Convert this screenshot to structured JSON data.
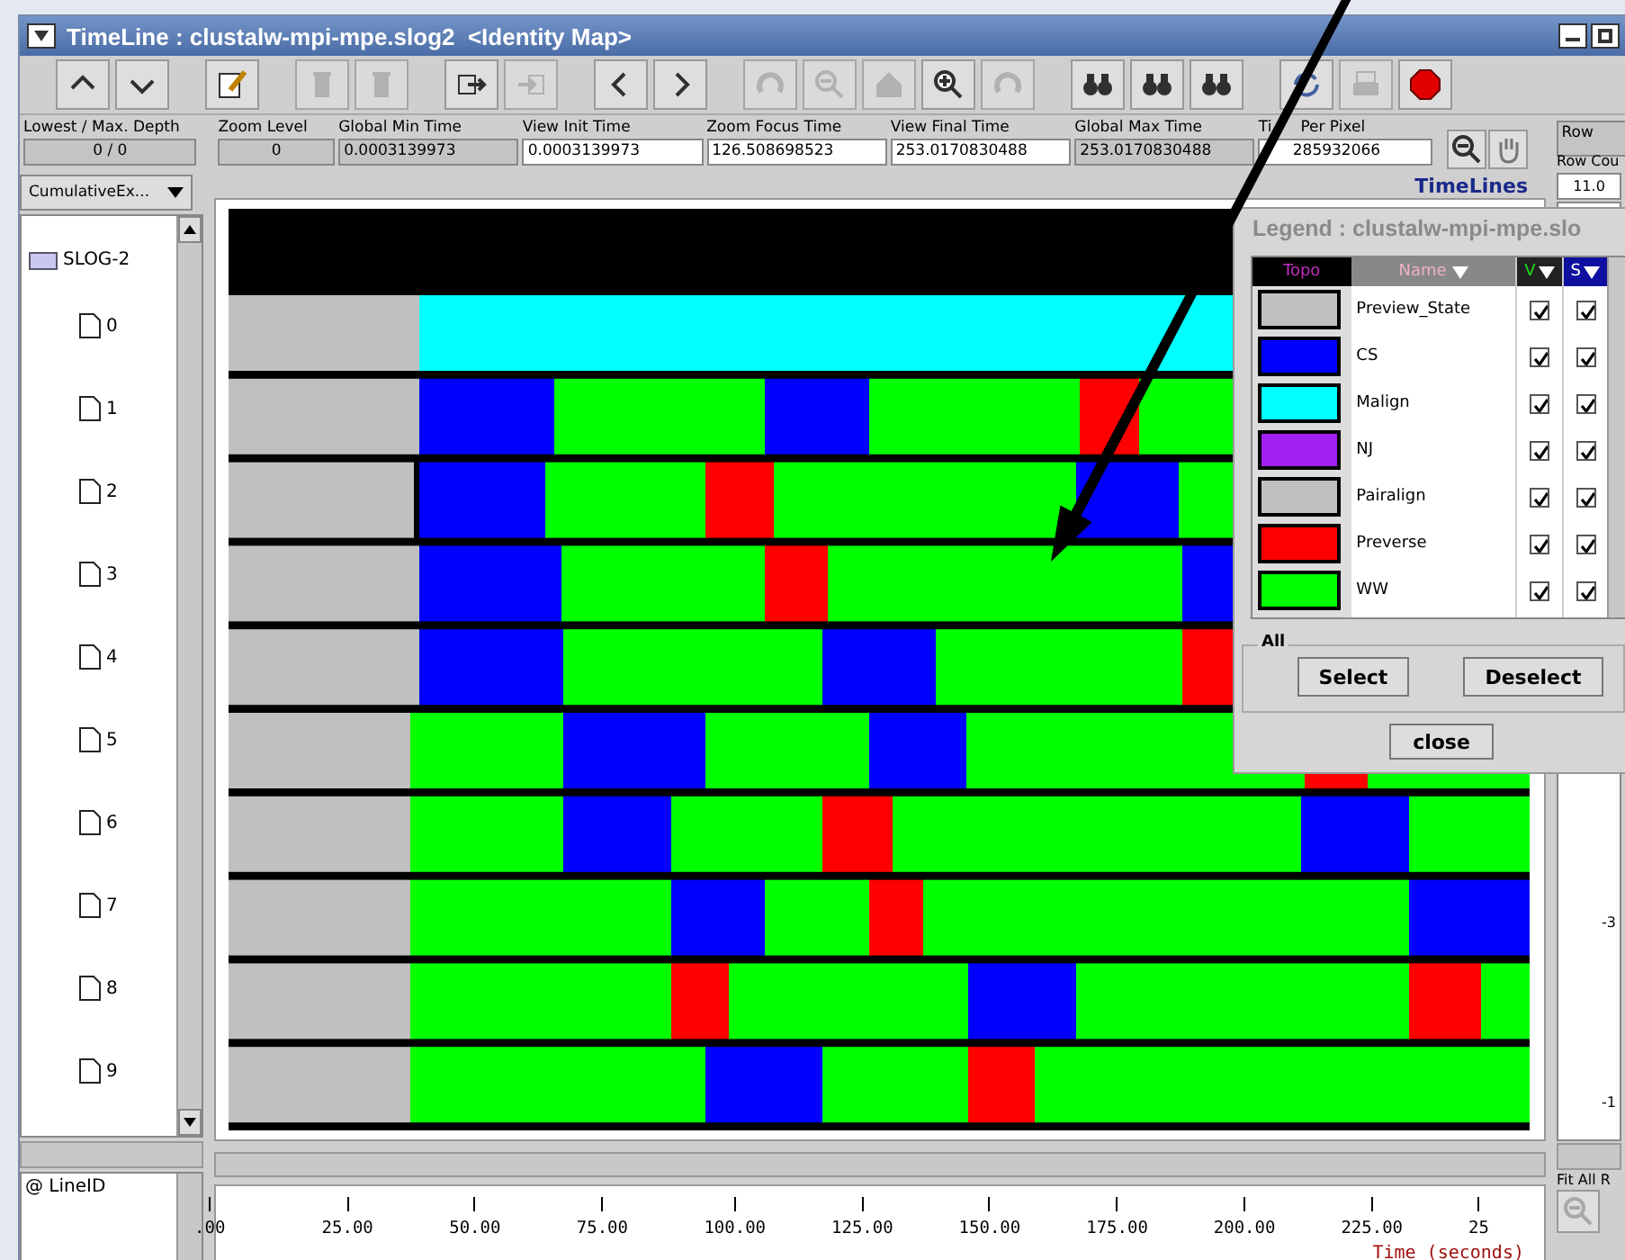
{
  "window": {
    "title": "TimeLine : clustalw-mpi-mpe.slog2  <Identity Map>"
  },
  "toolbar": [
    {
      "kind": "up",
      "disabled": false
    },
    {
      "kind": "down",
      "disabled": false
    },
    {
      "kind": "edit",
      "disabled": false
    },
    {
      "kind": "trash",
      "disabled": true
    },
    {
      "kind": "trash",
      "disabled": true
    },
    {
      "kind": "export",
      "disabled": false
    },
    {
      "kind": "import",
      "disabled": true
    },
    {
      "kind": "left",
      "disabled": false
    },
    {
      "kind": "right",
      "disabled": false
    },
    {
      "kind": "undo",
      "disabled": true
    },
    {
      "kind": "zoomout",
      "disabled": true
    },
    {
      "kind": "home",
      "disabled": true
    },
    {
      "kind": "zoomin",
      "disabled": false
    },
    {
      "kind": "redo",
      "disabled": true
    },
    {
      "kind": "binoculars",
      "disabled": false
    },
    {
      "kind": "binoculars",
      "disabled": false
    },
    {
      "kind": "binoculars",
      "disabled": false
    },
    {
      "kind": "refresh",
      "disabled": false
    },
    {
      "kind": "print",
      "disabled": true
    },
    {
      "kind": "stop",
      "disabled": false
    }
  ],
  "depth": {
    "label": "Lowest / Max. Depth",
    "value": "0 / 0"
  },
  "info_fields": [
    {
      "label": "Zoom Level",
      "value": "0",
      "editable": false
    },
    {
      "label": "Global Min Time",
      "value": "0.0003139973",
      "editable": false
    },
    {
      "label": "View  Init Time",
      "value": "0.0003139973",
      "editable": true
    },
    {
      "label": "Zoom Focus Time",
      "value": "126.508698523",
      "editable": true
    },
    {
      "label": "View Final Time",
      "value": "253.0170830488",
      "editable": true
    },
    {
      "label": "Global Max Time",
      "value": "253.0170830488",
      "editable": false
    },
    {
      "label_parts": [
        "Ti",
        "Per Pixel"
      ],
      "value": "285932066",
      "editable": true
    }
  ],
  "dropdown": {
    "value": "CumulativeEx..."
  },
  "tree": {
    "label": "SLOG-2",
    "expanded": true,
    "children": [
      {
        "label": "0"
      },
      {
        "label": "1"
      },
      {
        "label": "2"
      },
      {
        "label": "3"
      },
      {
        "label": "4"
      },
      {
        "label": "5"
      },
      {
        "label": "6"
      },
      {
        "label": "7"
      },
      {
        "label": "8"
      },
      {
        "label": "9"
      }
    ]
  },
  "line_id": {
    "label": "@ LineID"
  },
  "timelines_title": "TimeLines",
  "ruler": {
    "ticks": [
      ".00",
      "25.00",
      "50.00",
      "75.00",
      "100.00",
      "125.00",
      "150.00",
      "175.00",
      "200.00",
      "225.00",
      "25"
    ],
    "title": "Time (seconds)"
  },
  "right_panel": {
    "row_label": "Row",
    "count_label": "Row Cou",
    "count_value": "11.0",
    "scale": [
      "-3",
      "-1"
    ],
    "fit_label": "Fit All R"
  },
  "legend": {
    "title": "Legend : clustalw-mpi-mpe.slo",
    "columns": [
      "Topo",
      "Name",
      "V",
      "S"
    ],
    "entries": [
      {
        "name": "Preview_State",
        "color": "#c0c0c0",
        "visible": true,
        "searchable": true
      },
      {
        "name": "CS",
        "color": "#0000ff",
        "visible": true,
        "searchable": true
      },
      {
        "name": "Malign",
        "color": "#00ffff",
        "visible": true,
        "searchable": true
      },
      {
        "name": "NJ",
        "color": "#a020f0",
        "visible": true,
        "searchable": true
      },
      {
        "name": "Pairalign",
        "color": "#c0c0c0",
        "visible": true,
        "searchable": true
      },
      {
        "name": "Preverse",
        "color": "#ff0000",
        "visible": true,
        "searchable": true
      },
      {
        "name": "WW",
        "color": "#00ff00",
        "visible": true,
        "searchable": true
      }
    ],
    "group_label": "All",
    "buttons": [
      "Select",
      "Deselect"
    ],
    "close": "close"
  }
}
